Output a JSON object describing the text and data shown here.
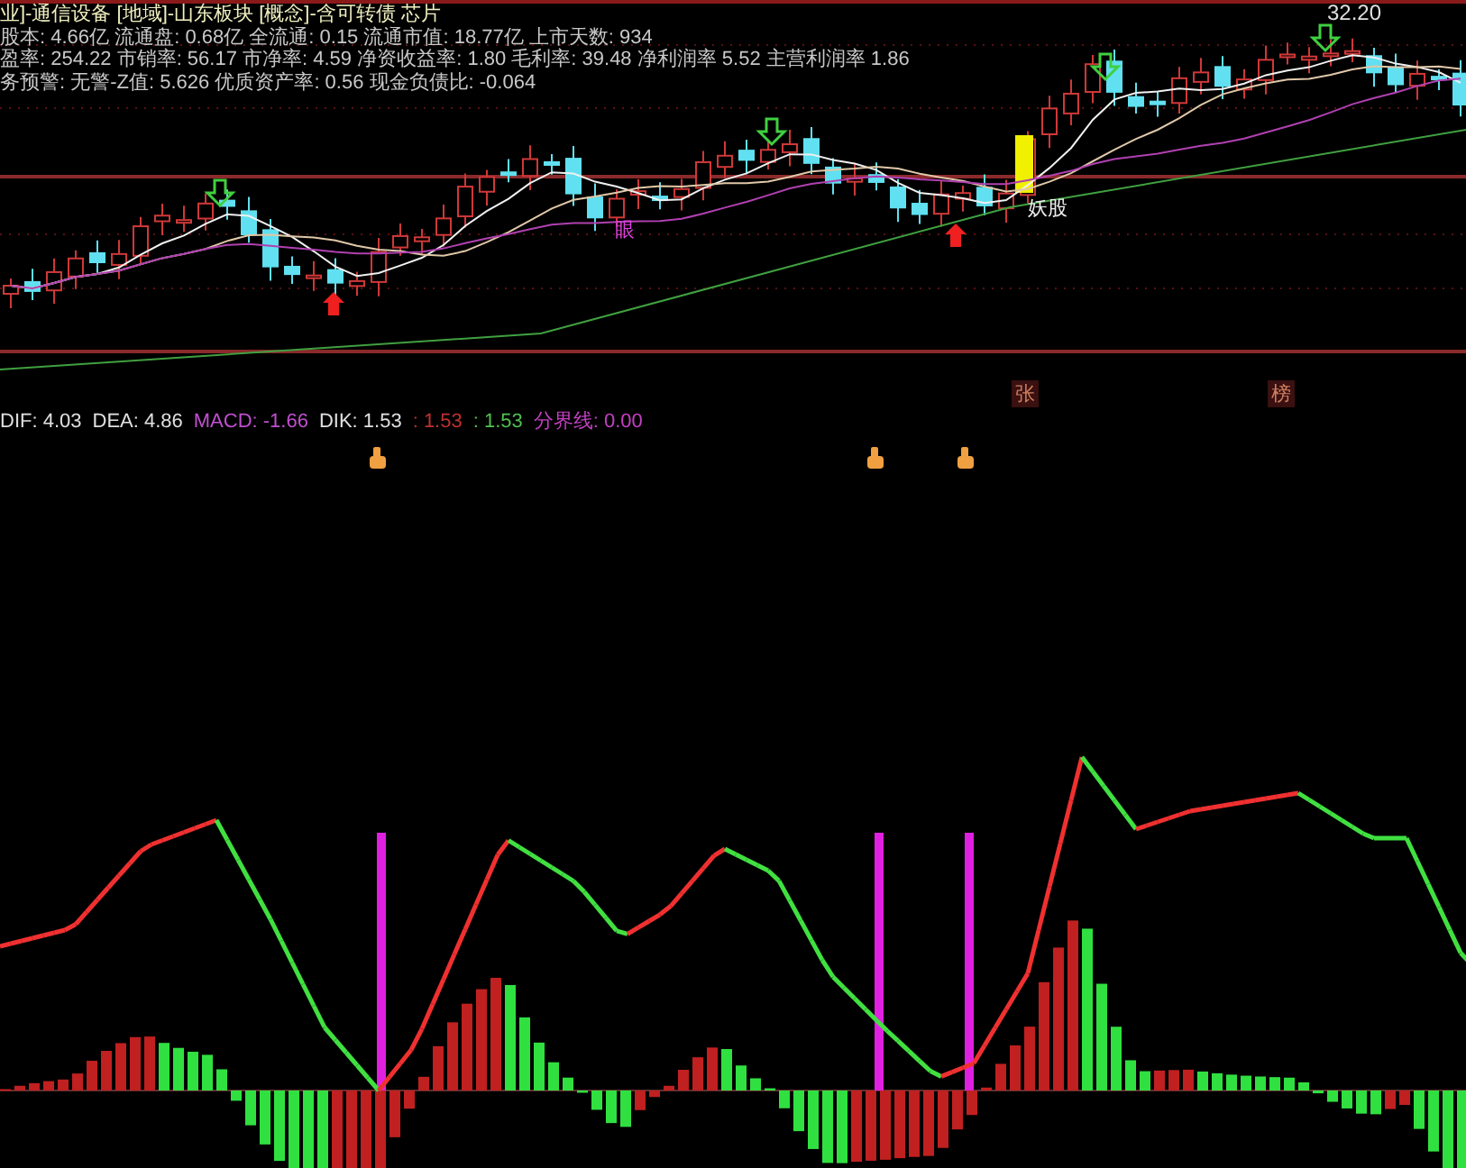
{
  "info_lines": [
    {
      "kind": "category",
      "text": "业]-通信设备 [地域]-山东板块 [概念]-含可转债 芯片"
    },
    {
      "kind": "stats",
      "text": "股本: 4.66亿 流通盘: 0.68亿 全流通: 0.15 流通市值: 18.77亿 上市天数: 934"
    },
    {
      "kind": "stats",
      "text": "盈率: 254.22 市销率: 56.17 市净率: 4.59 净资收益率: 1.80 毛利率: 39.48 净利润率 5.52 主营利润率 1.86"
    },
    {
      "kind": "stats",
      "text": "务预警: 无警-Z值: 5.626 优质资产率: 0.56 现金负债比: -0.064"
    }
  ],
  "price_chart": {
    "labels": [
      {
        "kind": "price",
        "text": "32.20"
      },
      {
        "kind": "signal",
        "text": "眼"
      },
      {
        "kind": "tag",
        "text": "妖股"
      },
      {
        "kind": "marker",
        "text": "张"
      },
      {
        "kind": "marker",
        "text": "榜"
      }
    ]
  },
  "indicator_legend": [
    {
      "text": "DIF: 4.03",
      "color": "#e0e0e0"
    },
    {
      "text": "DEA: 4.86",
      "color": "#e0e0e0"
    },
    {
      "text": "MACD: -1.66",
      "color": "#c050d0"
    },
    {
      "text": "DIK: 1.53",
      "color": "#e0e0e0"
    },
    {
      "text": ": 1.53",
      "color": "#c03030"
    },
    {
      "text": ": 1.53",
      "color": "#50c050"
    },
    {
      "text": "分界线: 0.00",
      "color": "#c040c0"
    }
  ]
}
